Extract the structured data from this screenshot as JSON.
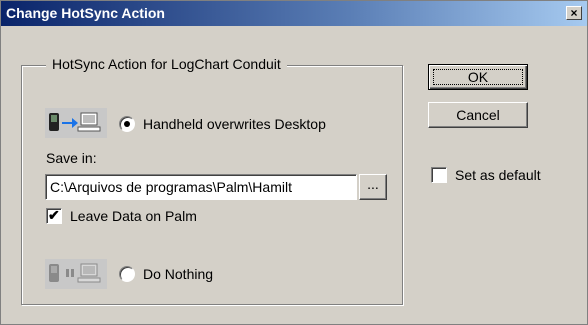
{
  "window": {
    "title": "Change HotSync Action",
    "close_label": "×"
  },
  "group": {
    "title": "HotSync Action for LogChart Conduit"
  },
  "options": {
    "handheld_overwrites": {
      "label": "Handheld overwrites Desktop",
      "selected": true
    },
    "do_nothing": {
      "label": "Do Nothing",
      "selected": false
    }
  },
  "save_in": {
    "label": "Save in:",
    "value": "C:\\Arquivos de programas\\Palm\\Hamilt",
    "browse_label": "..."
  },
  "leave_data": {
    "label": "Leave Data on Palm",
    "checked": true
  },
  "buttons": {
    "ok": "OK",
    "cancel": "Cancel"
  },
  "set_default": {
    "label": "Set as default",
    "checked": false
  },
  "icons": {
    "sync_overwrite": "handheld-arrow-desktop-icon",
    "sync_nothing": "handheld-pause-desktop-icon"
  },
  "colors": {
    "title_start": "#0a246a",
    "title_end": "#a6caf0",
    "face": "#d4d0c8",
    "arrow": "#1a73e8"
  }
}
